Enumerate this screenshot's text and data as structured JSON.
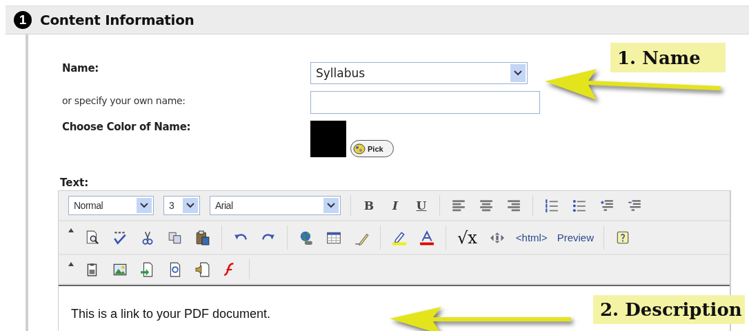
{
  "section": {
    "number": "1",
    "title": "Content Information"
  },
  "form": {
    "name_label": "Name:",
    "name_select": {
      "value": "Syllabus"
    },
    "own_name_label": "or specify your own name:",
    "color_label": "Choose Color of Name:",
    "color": "#000000",
    "pick_button": "Pick"
  },
  "editor": {
    "label": "Text:",
    "toolbars": [
      {
        "items": [
          {
            "kind": "select",
            "value": "Normal"
          },
          {
            "kind": "select",
            "value": "3"
          },
          {
            "kind": "select",
            "value": "Arial"
          },
          {
            "kind": "separator"
          },
          {
            "kind": "bold",
            "text": "B"
          },
          {
            "kind": "italic",
            "text": "I"
          },
          {
            "kind": "underline",
            "text": "U"
          },
          {
            "kind": "separator"
          },
          {
            "kind": "icon"
          },
          {
            "kind": "icon"
          },
          {
            "kind": "icon"
          },
          {
            "kind": "separator"
          },
          {
            "kind": "icon"
          },
          {
            "kind": "icon"
          },
          {
            "kind": "icon"
          },
          {
            "kind": "icon"
          }
        ]
      },
      {
        "items": [
          {
            "kind": "collapse"
          },
          {
            "kind": "icon"
          },
          {
            "kind": "icon"
          },
          {
            "kind": "icon"
          },
          {
            "kind": "icon"
          },
          {
            "kind": "icon"
          },
          {
            "kind": "separator"
          },
          {
            "kind": "icon"
          },
          {
            "kind": "icon"
          },
          {
            "kind": "separator"
          },
          {
            "kind": "icon"
          },
          {
            "kind": "icon"
          },
          {
            "kind": "icon"
          },
          {
            "kind": "separator"
          },
          {
            "kind": "icon"
          },
          {
            "kind": "icon"
          },
          {
            "kind": "separator"
          },
          {
            "kind": "math",
            "text": "√x"
          },
          {
            "kind": "icon"
          },
          {
            "kind": "text",
            "text": "<html>"
          },
          {
            "kind": "text",
            "text": "Preview"
          },
          {
            "kind": "separator"
          },
          {
            "kind": "icon"
          }
        ]
      },
      {
        "items": [
          {
            "kind": "collapse"
          },
          {
            "kind": "icon"
          },
          {
            "kind": "icon"
          },
          {
            "kind": "icon"
          },
          {
            "kind": "icon"
          },
          {
            "kind": "icon"
          },
          {
            "kind": "icon"
          },
          {
            "kind": "separator"
          }
        ]
      }
    ],
    "content": "This is a link to your PDF document."
  },
  "callouts": [
    {
      "text": "1. Name"
    },
    {
      "text": "2. Description"
    }
  ]
}
